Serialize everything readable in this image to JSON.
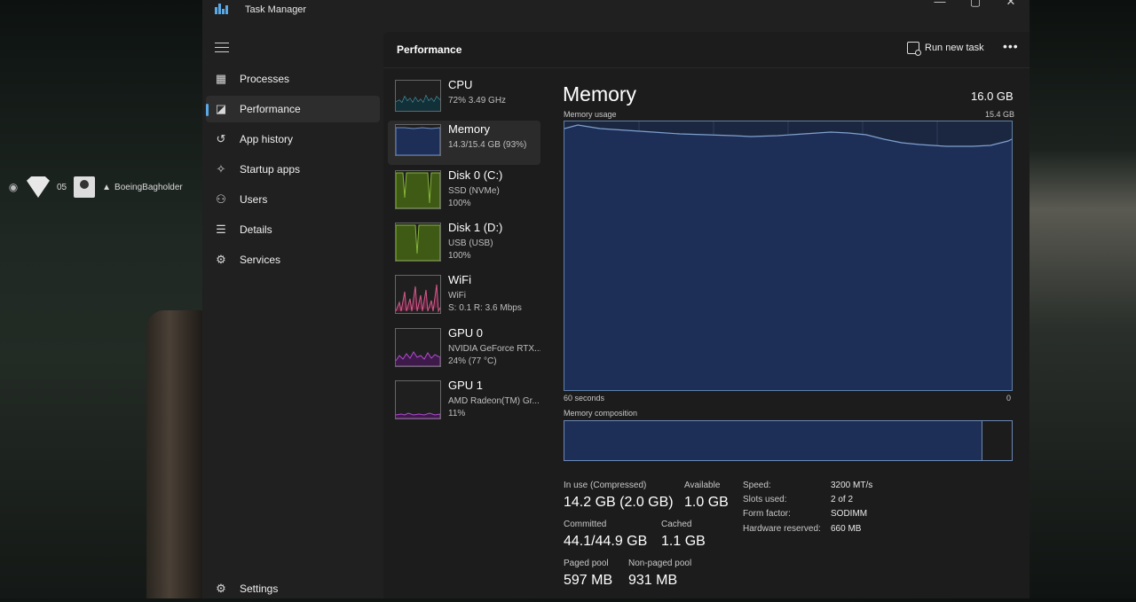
{
  "app": {
    "title": "Task Manager"
  },
  "overlay": {
    "count": "05",
    "username": "BoeingBagholder"
  },
  "nav": {
    "items": [
      {
        "label": "Processes",
        "icon": "processes-icon"
      },
      {
        "label": "Performance",
        "icon": "performance-icon"
      },
      {
        "label": "App history",
        "icon": "history-icon"
      },
      {
        "label": "Startup apps",
        "icon": "startup-icon"
      },
      {
        "label": "Users",
        "icon": "users-icon"
      },
      {
        "label": "Details",
        "icon": "details-icon"
      },
      {
        "label": "Services",
        "icon": "services-icon"
      }
    ],
    "settings": "Settings"
  },
  "header": {
    "title": "Performance",
    "run_task": "Run new task",
    "more": "•••"
  },
  "devices": [
    {
      "name": "CPU",
      "sub1": "72%  3.49 GHz",
      "sub2": "",
      "color": "#4fb3c8"
    },
    {
      "name": "Memory",
      "sub1": "14.3/15.4 GB (93%)",
      "sub2": "",
      "color": "#6f8fc0"
    },
    {
      "name": "Disk 0 (C:)",
      "sub1": "SSD (NVMe)",
      "sub2": "100%",
      "color": "#86b53a"
    },
    {
      "name": "Disk 1 (D:)",
      "sub1": "USB (USB)",
      "sub2": "100%",
      "color": "#86b53a"
    },
    {
      "name": "WiFi",
      "sub1": "WiFi",
      "sub2": "S: 0.1  R: 3.6 Mbps",
      "color": "#d35b8a"
    },
    {
      "name": "GPU 0",
      "sub1": "NVIDIA GeForce RTX...",
      "sub2": "24%  (77 °C)",
      "color": "#b14bd1"
    },
    {
      "name": "GPU 1",
      "sub1": "AMD Radeon(TM) Gr...",
      "sub2": "11%",
      "color": "#b14bd1"
    }
  ],
  "memory": {
    "title": "Memory",
    "total": "16.0 GB",
    "usage_label": "Memory usage",
    "usage_max": "15.4 GB",
    "time_left": "60 seconds",
    "time_right": "0",
    "composition_label": "Memory composition",
    "stats": {
      "in_use_label": "In use (Compressed)",
      "in_use": "14.2 GB (2.0 GB)",
      "available_label": "Available",
      "available": "1.0 GB",
      "committed_label": "Committed",
      "committed": "44.1/44.9 GB",
      "cached_label": "Cached",
      "cached": "1.1 GB",
      "paged_label": "Paged pool",
      "paged": "597 MB",
      "nonpaged_label": "Non-paged pool",
      "nonpaged": "931 MB"
    },
    "props": {
      "speed_label": "Speed:",
      "speed": "3200 MT/s",
      "slots_label": "Slots used:",
      "slots": "2 of 2",
      "form_label": "Form factor:",
      "form": "SODIMM",
      "reserved_label": "Hardware reserved:",
      "reserved": "660 MB"
    }
  }
}
